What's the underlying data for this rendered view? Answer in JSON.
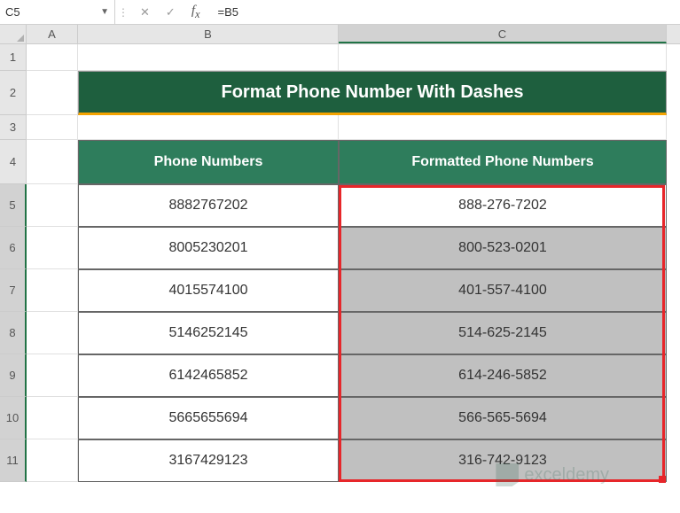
{
  "nameBox": {
    "value": "C5"
  },
  "formulaBar": {
    "formula": "=B5"
  },
  "columns": {
    "A": "A",
    "B": "B",
    "C": "C"
  },
  "rows": [
    "1",
    "2",
    "3",
    "4",
    "5",
    "6",
    "7",
    "8",
    "9",
    "10",
    "11"
  ],
  "title": "Format Phone Number With Dashes",
  "headers": {
    "colB": "Phone Numbers",
    "colC": "Formatted Phone Numbers"
  },
  "data": [
    {
      "raw": "8882767202",
      "formatted": "888-276-7202"
    },
    {
      "raw": "8005230201",
      "formatted": "800-523-0201"
    },
    {
      "raw": "4015574100",
      "formatted": "401-557-4100"
    },
    {
      "raw": "5146252145",
      "formatted": "514-625-2145"
    },
    {
      "raw": "6142465852",
      "formatted": "614-246-5852"
    },
    {
      "raw": "5665655694",
      "formatted": "566-565-5694"
    },
    {
      "raw": "3167429123",
      "formatted": "316-742-9123"
    }
  ],
  "watermark": "exceldemy",
  "chart_data": {
    "type": "table",
    "title": "Format Phone Number With Dashes",
    "columns": [
      "Phone Numbers",
      "Formatted Phone Numbers"
    ],
    "rows": [
      [
        "8882767202",
        "888-276-7202"
      ],
      [
        "8005230201",
        "800-523-0201"
      ],
      [
        "4015574100",
        "401-557-4100"
      ],
      [
        "5146252145",
        "514-625-2145"
      ],
      [
        "6142465852",
        "614-246-5852"
      ],
      [
        "5665655694",
        "566-565-5694"
      ],
      [
        "3167429123",
        "316-742-9123"
      ]
    ]
  }
}
